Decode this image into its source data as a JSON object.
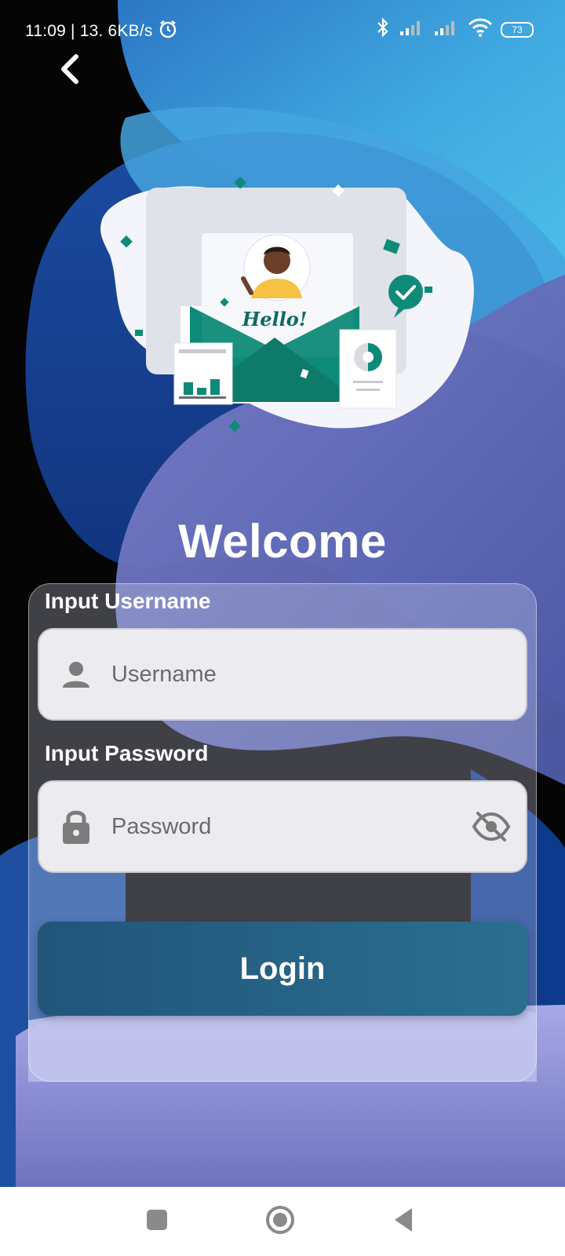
{
  "status_bar": {
    "time_speed": "11:09 | 13. 6KB/s",
    "battery": "73"
  },
  "header": {
    "back_icon": "chevron-left-icon"
  },
  "illustration": {
    "greeting": "Hello!"
  },
  "title": "Welcome",
  "form": {
    "username": {
      "label": "Input Username",
      "placeholder": "Username",
      "icon": "person-icon"
    },
    "password": {
      "label": "Input Password",
      "placeholder": "Password",
      "icon": "lock-icon",
      "toggle_icon": "eye-off-icon"
    },
    "login_label": "Login"
  },
  "nav": {
    "recents_icon": "square-icon",
    "home_icon": "circle-icon",
    "back_icon": "triangle-back-icon"
  },
  "colors": {
    "accent_teal": "#0f8a78",
    "button": "#25607f",
    "input_bg": "#ececf0"
  }
}
